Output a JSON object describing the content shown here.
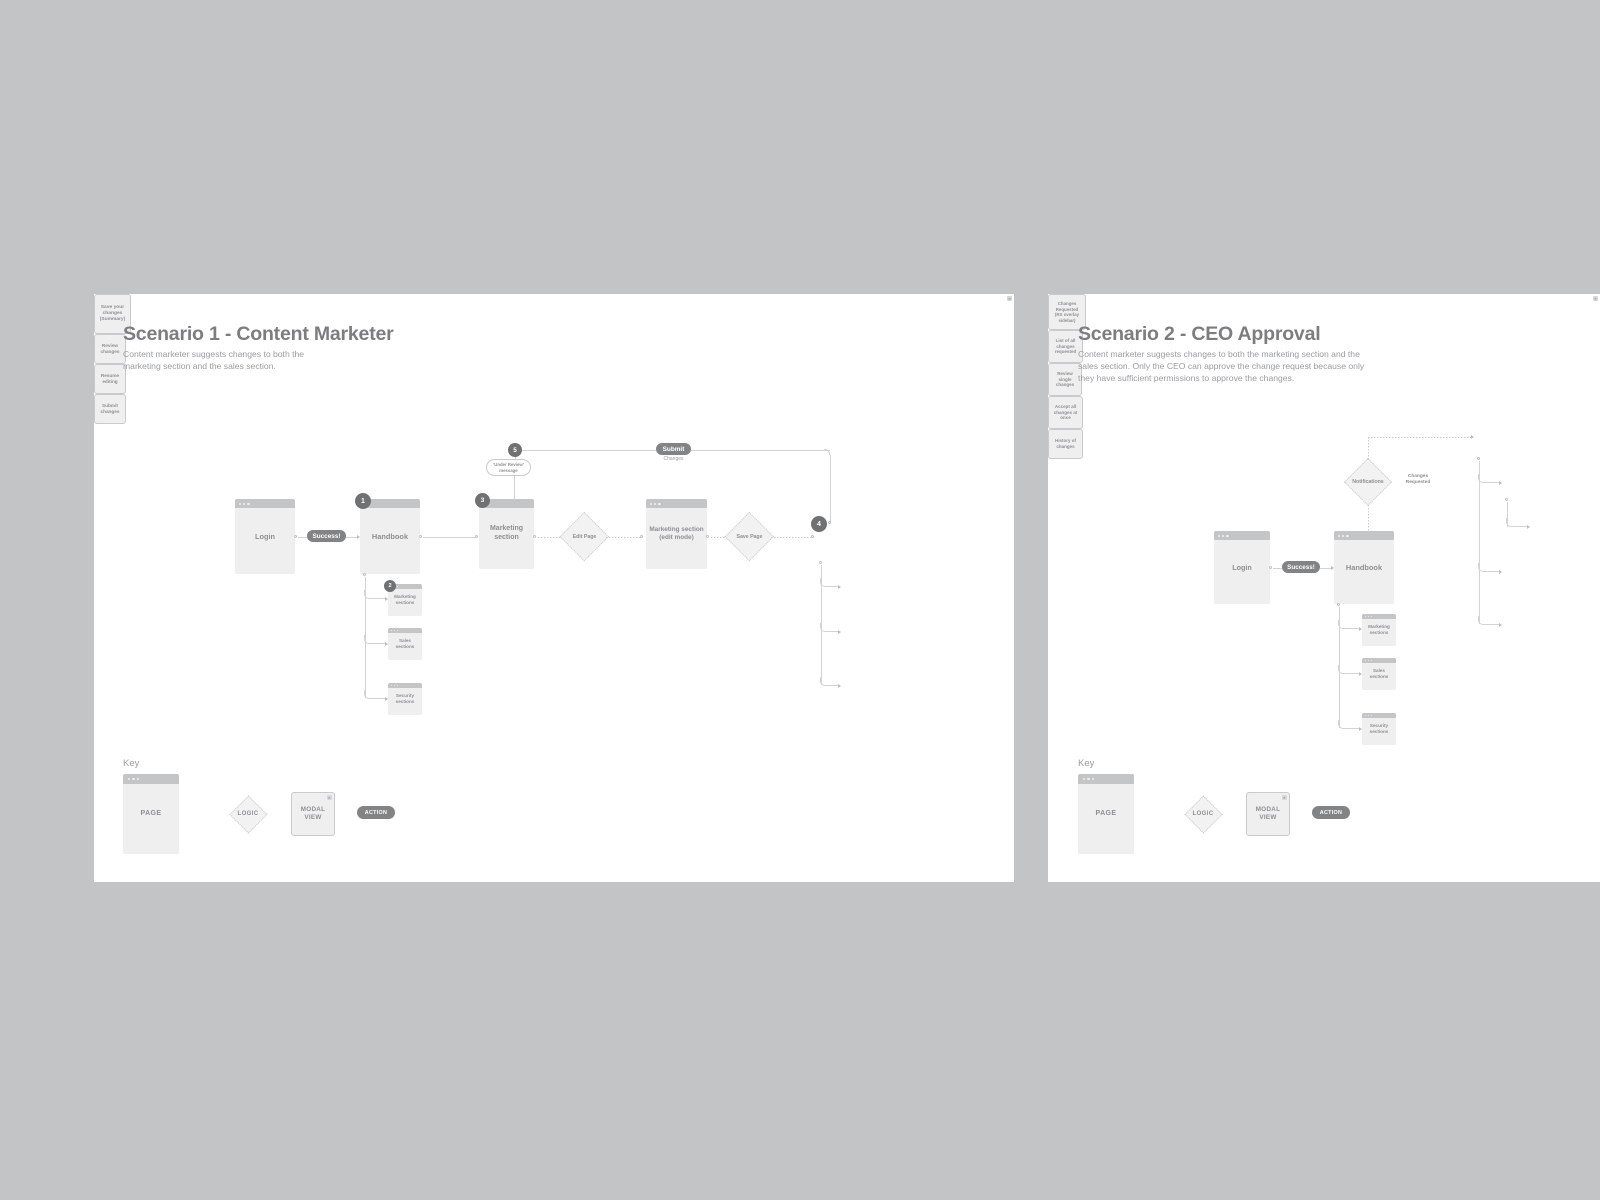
{
  "canvas": {
    "background": "#c3c4c5"
  },
  "boards": [
    {
      "id": "scenario-1",
      "title": "Scenario 1 - Content Marketer",
      "description": "Content marketer suggests changes to both the\nmarketing section and the sales section.",
      "key": {
        "label": "Key",
        "page": "PAGE",
        "logic": "LOGIC",
        "modal": "MODAL\nVIEW",
        "modal_line1": "MODAL",
        "modal_line2": "VIEW",
        "action": "ACTION",
        "close": "×"
      },
      "nodes": {
        "login": "Login",
        "handbook": "Handbook",
        "marketing_section": "Marketing\nsection",
        "marketing_section_line1": "Marketing",
        "marketing_section_line2": "section",
        "marketing_sections": "Marketing\nsections",
        "marketing_sections_line1": "Marketing",
        "marketing_sections_line2": "sections",
        "sales_sections_line1": "Sales",
        "sales_sections_line2": "sections",
        "security_sections_line1": "Security",
        "security_sections_line2": "sections",
        "edit_page": "Edit Page",
        "marketing_edit_line1": "Marketing section",
        "marketing_edit_line2": "(edit mode)",
        "save_page": "Save Page",
        "save_changes_line1": "Save your",
        "save_changes_line2": "changes",
        "save_changes_line3": "(Summary)",
        "review_changes_line1": "Review",
        "review_changes_line2": "changes",
        "resume_editing_line1": "Resume",
        "resume_editing_line2": "editing",
        "submit_changes_line1": "Submit",
        "submit_changes_line2": "changes",
        "under_review_line1": "'Under Review'",
        "under_review_line2": "message"
      },
      "actions": {
        "success": "Success!",
        "submit": "Submit",
        "submit_sub": "Changes"
      },
      "badges": [
        "1",
        "2",
        "3",
        "4",
        "5"
      ],
      "close_icon": "×"
    },
    {
      "id": "scenario-2",
      "title": "Scenario 2 - CEO Approval",
      "description": "Content marketer suggests changes to both the marketing section and the\nsales section. Only the CEO can approve the change request because only\nthey have sufficient permissions to approve the changes.",
      "key": {
        "label": "Key",
        "page": "PAGE",
        "logic": "LOGIC",
        "modal_line1": "MODAL",
        "modal_line2": "VIEW",
        "action": "ACTION",
        "close": "×"
      },
      "nodes": {
        "login": "Login",
        "handbook": "Handbook",
        "marketing_sections_line1": "Marketing",
        "marketing_sections_line2": "sections",
        "sales_sections_line1": "Sales",
        "sales_sections_line2": "sections",
        "security_sections_line1": "Security",
        "security_sections_line2": "sections",
        "notifications": "Notifications",
        "changes_requested_label_line1": "Changes",
        "changes_requested_label_line2": "Requested",
        "changes_requested_line1": "Changes",
        "changes_requested_line2": "Requested",
        "changes_requested_line3": "(RX overlay",
        "changes_requested_line4": "sidebar)",
        "list_changes_line1": "List of all",
        "list_changes_line2": "changes",
        "list_changes_line3": "requested",
        "review_single_line1": "Review",
        "review_single_line2": "single",
        "review_single_line3": "changes",
        "accept_all_line1": "Accept all",
        "accept_all_line2": "changes at",
        "accept_all_line3": "once",
        "history_line1": "History of",
        "history_line2": "changes"
      },
      "actions": {
        "success": "Success!"
      },
      "close_icon": "×"
    }
  ]
}
